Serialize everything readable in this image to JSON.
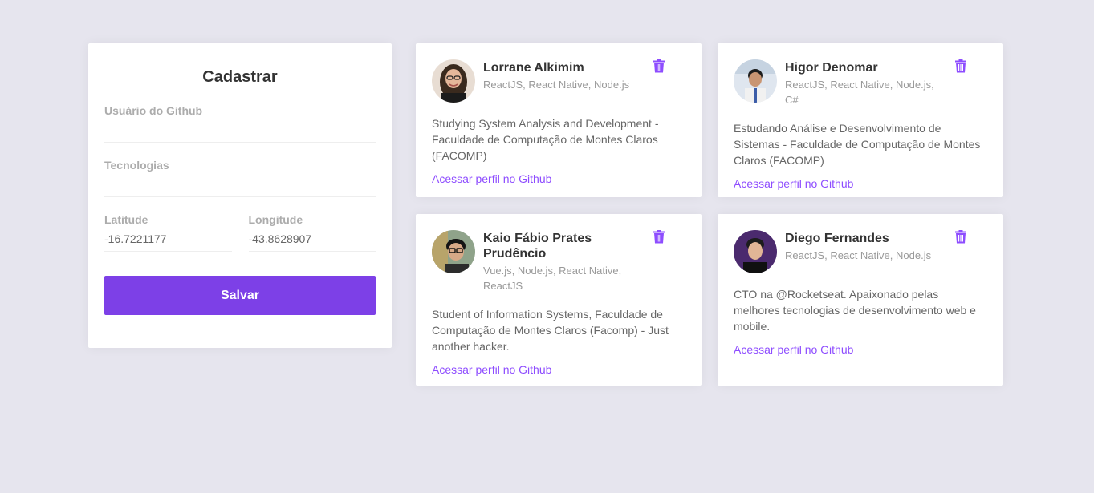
{
  "form": {
    "title": "Cadastrar",
    "github_label": "Usuário do Github",
    "github_value": "",
    "techs_label": "Tecnologias",
    "techs_value": "",
    "latitude_label": "Latitude",
    "latitude_value": "-16.7221177",
    "longitude_label": "Longitude",
    "longitude_value": "-43.8628907",
    "save_label": "Salvar"
  },
  "colors": {
    "accent": "#7d40e7",
    "link": "#8e4dff",
    "background": "#e6e5ee"
  },
  "devs": [
    {
      "name": "Lorrane Alkimim",
      "techs": "ReactJS, React Native, Node.js",
      "bio": "Studying System Analysis and Development - Faculdade de Computação de Montes Claros (FACOMP)",
      "link": "Acessar perfil no Github",
      "delete_icon": "trash-icon"
    },
    {
      "name": "Higor Denomar",
      "techs": "ReactJS, React Native, Node.js, C#",
      "bio": "Estudando Análise e Desenvolvimento de Sistemas - Faculdade de Computação de Montes Claros (FACOMP)",
      "link": "Acessar perfil no Github",
      "delete_icon": "trash-icon"
    },
    {
      "name": "Kaio Fábio Prates Prudêncio",
      "techs": "Vue.js, Node.js, React Native, ReactJS",
      "bio": "Student of Information Systems, Faculdade de Computação de Montes Claros (Facomp) - Just another hacker.",
      "link": "Acessar perfil no Github",
      "delete_icon": "trash-icon"
    },
    {
      "name": "Diego Fernandes",
      "techs": "ReactJS, React Native, Node.js",
      "bio": "CTO na @Rocketseat. Apaixonado pelas melhores tecnologias de desenvolvimento web e mobile.",
      "link": "Acessar perfil no Github",
      "delete_icon": "trash-icon"
    }
  ]
}
